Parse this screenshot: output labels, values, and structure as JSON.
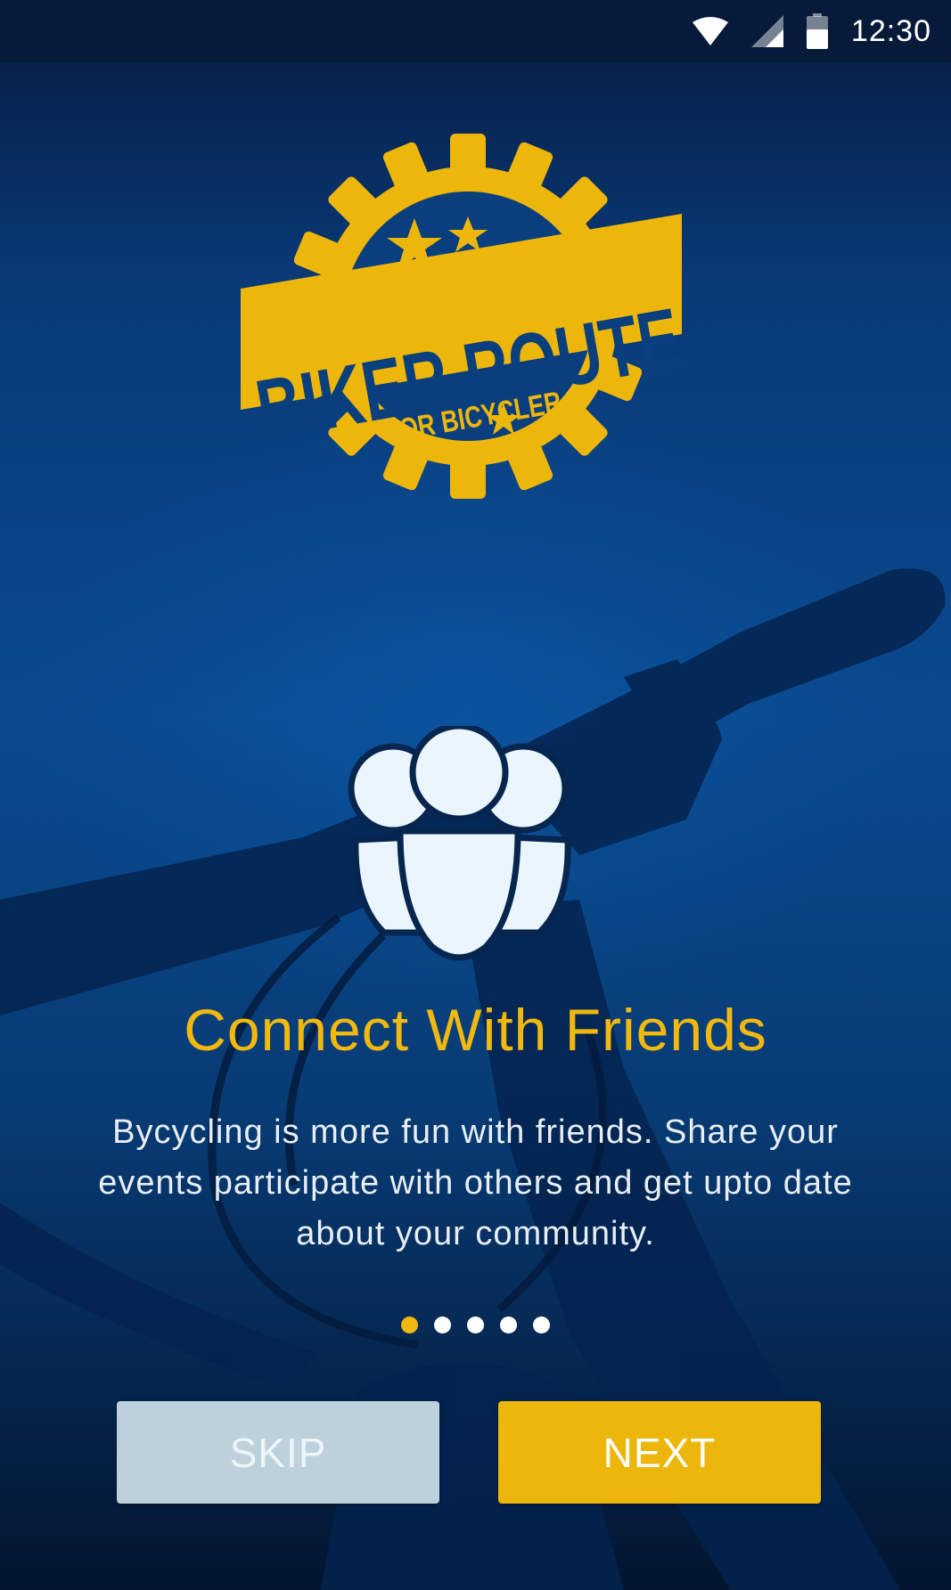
{
  "status_bar": {
    "time": "12:30",
    "icons": [
      "wifi-icon",
      "cell-signal-icon",
      "battery-icon"
    ]
  },
  "logo": {
    "title": "BIKER ROUTE",
    "subtitle": "FOR BICYCLER"
  },
  "onboarding": {
    "feature_icon": "friends-icon",
    "title": "Connect With Friends",
    "description": "Bycycling is more fun with friends. Share your events participate with others and get upto date about your community.",
    "page_indicator": {
      "current": 1,
      "total": 5
    }
  },
  "buttons": {
    "skip_label": "SKIP",
    "next_label": "NEXT"
  },
  "colors": {
    "accent": "#F1B80E",
    "background": "#0A4A8F",
    "skip_button": "#BDD1DC"
  }
}
